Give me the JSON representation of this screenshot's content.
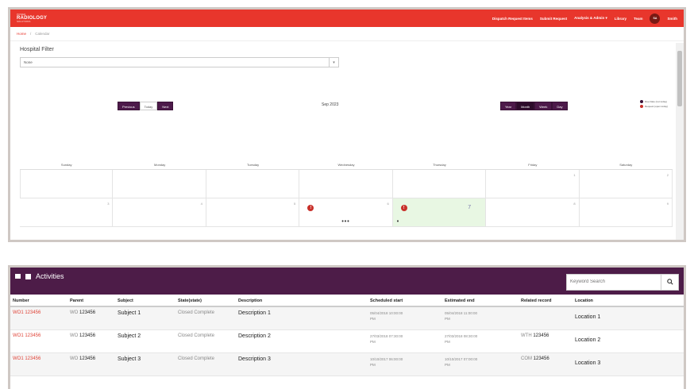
{
  "navbar": {
    "logo_small": "POWER",
    "logo_main": "RADIOLOGY",
    "logo_tag": "SOLUTIONS",
    "items": [
      "Dispatch Request Items",
      "Submit Request",
      "Analysis & Admin",
      "Library",
      "Team"
    ],
    "analysis_caret": "▾",
    "avatar": "SA",
    "user": "Smith"
  },
  "breadcrumb": {
    "home": "Home",
    "sep": "/",
    "current": "Calendar"
  },
  "filter": {
    "label": "Hospital Filter",
    "value": "None"
  },
  "calendar": {
    "nav_buttons": [
      "Previous",
      "Today",
      "Next"
    ],
    "view_buttons": [
      "Year",
      "Month",
      "Week",
      "Day"
    ],
    "month_title": "Sep 2023",
    "legend": [
      {
        "label": "Due Date (not today)",
        "color": "#3a1237"
      },
      {
        "label": "Request (open today)",
        "color": "#c8302a"
      }
    ],
    "weekdays": [
      "Sunday",
      "Monday",
      "Tuesday",
      "Wednesday",
      "Thursday",
      "Friday",
      "Saturday"
    ],
    "row1": [
      "",
      "",
      "",
      "",
      "",
      "1",
      "2"
    ],
    "row2": [
      "3",
      "4",
      "5",
      "6",
      "7",
      "8",
      "9"
    ],
    "event_badge": "!",
    "more_wed": "•••",
    "more_thu": "•"
  },
  "activities": {
    "title": "Activities",
    "search_placeholder": "Keyword Search",
    "columns": [
      "Number",
      "Parent",
      "Subject",
      "State(state)",
      "Description",
      "Scheduled start",
      "Estimated end",
      "Related record",
      "Location"
    ],
    "rows": [
      {
        "number": "WO1 123456",
        "parent_prefix": "WO",
        "parent_num": "123456",
        "subject": "Subject 1",
        "state": "Closed Complete",
        "description": "Description 1",
        "start_line1": "05/04/2018 10:00:00",
        "start_line2": "PM",
        "end_line1": "05/04/2018 11:00:00",
        "end_line2": "PM",
        "rel_prefix": "",
        "rel_num": "",
        "location": "Location 1"
      },
      {
        "number": "WO1 123456",
        "parent_prefix": "WO",
        "parent_num": "123456",
        "subject": "Subject 2",
        "state": "Closed Complete",
        "description": "Description 2",
        "start_line1": "27/03/2018 07:30:00",
        "start_line2": "PM",
        "end_line1": "27/03/2018 08:30:00",
        "end_line2": "PM",
        "rel_prefix": "WTH",
        "rel_num": "123456",
        "location": "Location 2"
      },
      {
        "number": "WO1 123456",
        "parent_prefix": "WO",
        "parent_num": "123456",
        "subject": "Subject 3",
        "state": "Closed Complete",
        "description": "Description 3",
        "start_line1": "10/10/2017 06:00:00",
        "start_line2": "PM",
        "end_line1": "10/10/2017 07:00:00",
        "end_line2": "PM",
        "rel_prefix": "COM",
        "rel_num": "123456",
        "location": "Location 3"
      }
    ]
  }
}
